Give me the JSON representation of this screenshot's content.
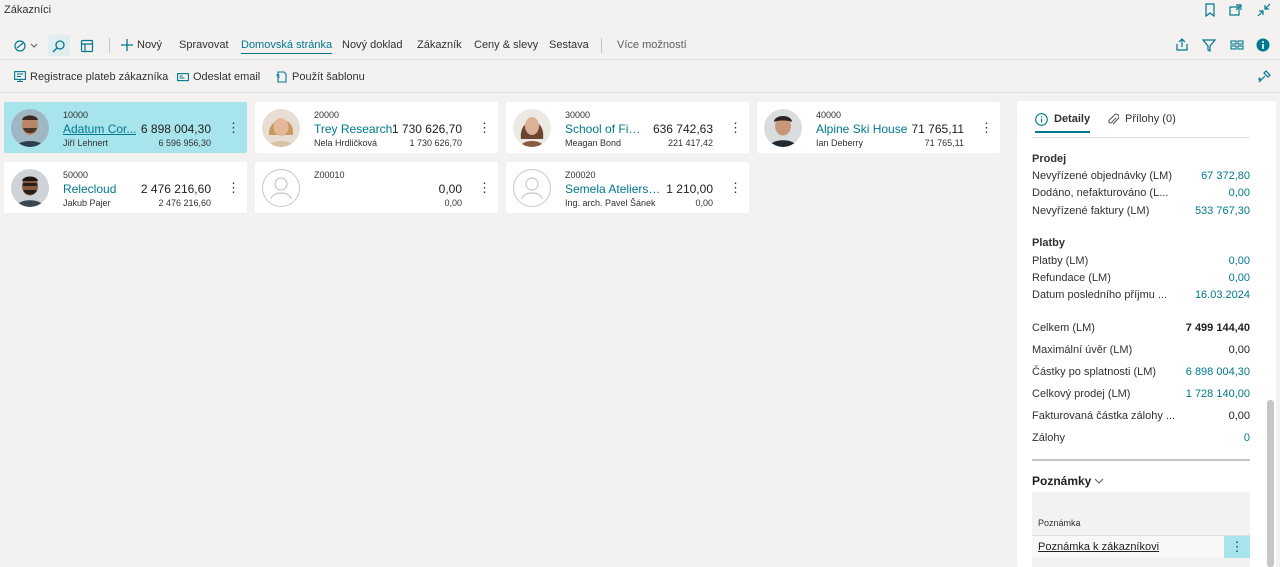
{
  "window": {
    "title": "Zákazníci",
    "icons": [
      "bookmark-icon",
      "open-new-window-icon",
      "collapse-icon"
    ]
  },
  "actionbar": {
    "new_label": "Nový",
    "items": [
      "Spravovat",
      "Domovská stránka",
      "Nový doklad",
      "Zákazník",
      "Ceny & slevy",
      "Sestava"
    ],
    "active": "Domovská stránka",
    "more_label": "Více možností",
    "right_icons": [
      "share-icon",
      "filter-icon",
      "list-view-icon",
      "info-icon"
    ]
  },
  "promoted": {
    "items": [
      {
        "label": "Registrace plateb zákazníka",
        "icon": "payment-registration-icon"
      },
      {
        "label": "Odeslat email",
        "icon": "email-icon"
      },
      {
        "label": "Použít šablonu",
        "icon": "template-icon"
      }
    ]
  },
  "tiles": [
    {
      "no": "10000",
      "name": "Adatum Cor...",
      "contact": "Jiří Lehnert",
      "balance": "6 898 004,30",
      "due": "6 596 956,30",
      "avatar": "photo",
      "selected": true
    },
    {
      "no": "20000",
      "name": "Trey Research",
      "contact": "Nela Hrdličková",
      "balance": "1 730 626,70",
      "due": "1 730 626,70",
      "avatar": "photo",
      "selected": false
    },
    {
      "no": "30000",
      "name": "School of Fin...",
      "contact": "Meagan Bond",
      "balance": "636 742,63",
      "due": "221 417,42",
      "avatar": "photo",
      "selected": false
    },
    {
      "no": "40000",
      "name": "Alpine Ski House",
      "contact": "Ian Deberry",
      "balance": "71 765,11",
      "due": "71 765,11",
      "avatar": "photo",
      "selected": false
    },
    {
      "no": "50000",
      "name": "Relecloud",
      "contact": "Jakub Pajer",
      "balance": "2 476 216,60",
      "due": "2 476 216,60",
      "avatar": "photo",
      "selected": false
    },
    {
      "no": "Z00010",
      "name": "",
      "contact": "",
      "balance": "0,00",
      "due": "0,00",
      "avatar": "blank",
      "selected": false
    },
    {
      "no": "Z00020",
      "name": "Semela Ateliers ...",
      "contact": "Ing. arch. Pavel Šánek",
      "balance": "1 210,00",
      "due": "0,00",
      "avatar": "blank",
      "selected": false
    }
  ],
  "factbox": {
    "tabs": {
      "details": "Detaily",
      "attachments": "Přílohy (0)"
    },
    "prodej": {
      "title": "Prodej",
      "rows": [
        {
          "label": "Nevyřízené objednávky (LM)",
          "value": "67 372,80"
        },
        {
          "label": "Dodáno, nefakturováno (L...",
          "value": "0,00"
        },
        {
          "label": "Nevyřízené faktury (LM)",
          "value": "533 767,30"
        }
      ]
    },
    "platby": {
      "title": "Platby",
      "rows": [
        {
          "label": "Platby (LM)",
          "value": "0,00"
        },
        {
          "label": "Refundace (LM)",
          "value": "0,00"
        },
        {
          "label": "Datum posledního příjmu ...",
          "value": "16.03.2024"
        }
      ]
    },
    "totals": [
      {
        "label": "Celkem (LM)",
        "value": "7 499 144,40"
      },
      {
        "label": "Maximální úvěr (LM)",
        "value": "0,00"
      },
      {
        "label": "Částky po splatnosti (LM)",
        "value": "6 898 004,30"
      },
      {
        "label": "Celkový prodej (LM)",
        "value": "1 728 140,00"
      },
      {
        "label": "Fakturovaná částka zálohy ...",
        "value": "0,00"
      },
      {
        "label": "Zálohy",
        "value": "0"
      }
    ],
    "notes": {
      "title": "Poznámky",
      "column": "Poznámka",
      "link": "Poznámka k zákazníkovi"
    }
  },
  "colors": {
    "accent": "#00788f",
    "selected_tile": "#a7e4ec",
    "background": "#f3f2f1"
  }
}
